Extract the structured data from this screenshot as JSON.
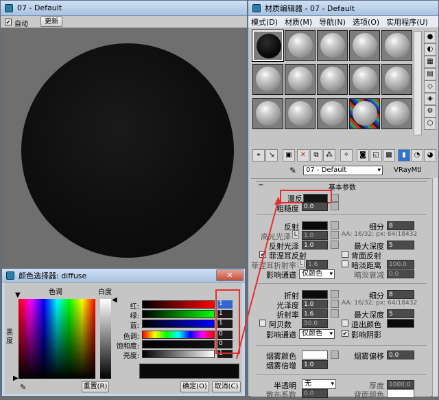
{
  "render_window": {
    "title": "07 - Default",
    "auto_label": "自动",
    "update_label": "更新"
  },
  "editor": {
    "title": "材质编辑器 - 07 - Default",
    "menu": [
      "模式(D)",
      "材质(M)",
      "导航(N)",
      "选项(O)",
      "实用程序(U)"
    ],
    "material_name": "07 - Default",
    "material_type": "VRayMtl",
    "rollout_title": "基本参数",
    "diffuse": {
      "label": "漫反射",
      "rough_label": "粗糙度",
      "rough_value": "0.0"
    },
    "reflect": {
      "label": "反射",
      "hilight_label": "高光光泽",
      "hilight_lock": "L",
      "hilight_value": "1.0",
      "gloss_label": "反射光泽",
      "gloss_value": "1.0",
      "fresnel_label": "菲涅耳反射",
      "fresnel_ior_label": "菲涅耳折射率",
      "fresnel_ior_lock": "L",
      "fresnel_ior_value": "1.6",
      "channel_label": "影响通道",
      "channel_value": "仅颜色",
      "subdivs_label": "细分",
      "subdivs_value": "8",
      "aa_text": "AA: 16/32; px: 64/18432",
      "depth_label": "最大深度",
      "depth_value": "5",
      "backside_label": "背面反射",
      "dim_label": "暗淡距离",
      "dim_value": "100.0",
      "falloff_label": "暗淡衰减",
      "falloff_value": "0.0"
    },
    "refract": {
      "label": "折射",
      "gloss_label": "光泽度",
      "gloss_value": "1.0",
      "ior_label": "折射率",
      "ior_value": "1.6",
      "abbe_label": "阿贝数",
      "abbe_value": "50.0",
      "channel_label": "影响通道",
      "channel_value": "仅颜色",
      "subdivs_label": "细分",
      "subdivs_value": "8",
      "aa_text": "AA: 16/32; px: 64/18432",
      "depth_label": "最大深度",
      "depth_value": "5",
      "exit_label": "退出颜色",
      "shadow_label": "影响阴影"
    },
    "fog": {
      "color_label": "烟雾颜色",
      "mult_label": "烟雾倍增",
      "mult_value": "1.0",
      "bias_label": "烟雾偏移",
      "bias_value": "0.0"
    },
    "translucency": {
      "label": "半透明",
      "value": "无",
      "scatter_label": "散布系数",
      "scatter_value": "0.0",
      "thickness_label": "厚度",
      "thickness_value": "1000.0",
      "back_label": "背面颜色"
    }
  },
  "color_picker": {
    "title": "颜色选择器: diffuse",
    "hue_label": "色调",
    "white_label": "白度",
    "black_label": "黑度",
    "red_label": "红:",
    "red_value": "1",
    "green_label": "绿:",
    "green_value": "1",
    "blue_label": "蓝:",
    "blue_value": "1",
    "hue2_label": "色调:",
    "hue2_value": "0",
    "sat_label": "饱和度:",
    "sat_value": "0",
    "value_label": "亮度:",
    "value_value": "1",
    "reset_label": "重置(R)",
    "ok_label": "确定(O)",
    "cancel_label": "取消(C)"
  },
  "colors": {
    "accent_red": "#e3302f",
    "title_blue": "#b5c7dc"
  }
}
